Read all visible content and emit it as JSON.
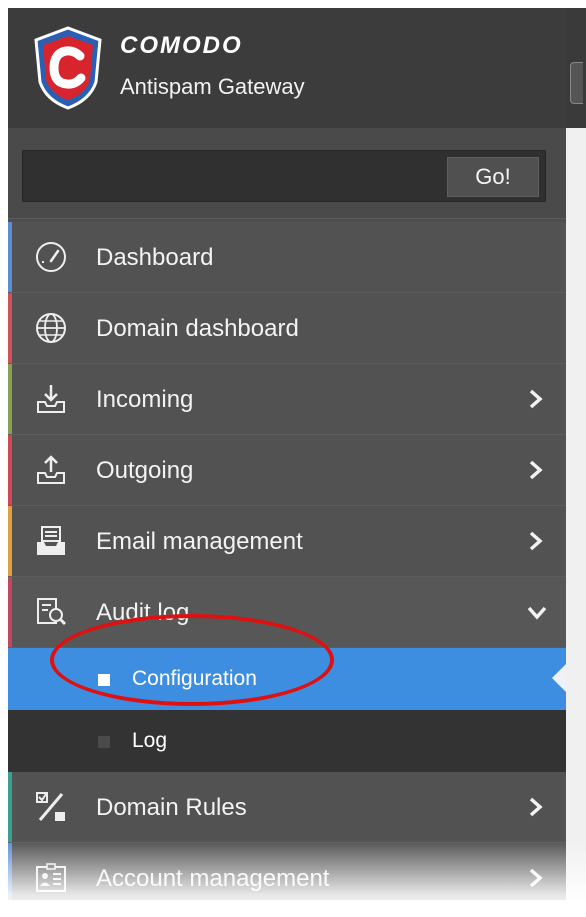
{
  "brand": {
    "name": "COMODO",
    "product": "Antispam Gateway"
  },
  "search": {
    "value": "",
    "placeholder": "",
    "button_label": "Go!"
  },
  "menu": {
    "items": [
      {
        "label": "Dashboard",
        "icon": "dashboard-gauge-icon",
        "stripe": "#5a8fd8",
        "has_arrow": false
      },
      {
        "label": "Domain dashboard",
        "icon": "globe-icon",
        "stripe": "#d0505a",
        "has_arrow": false
      },
      {
        "label": "Incoming",
        "icon": "inbox-download-icon",
        "stripe": "#8aa050",
        "has_arrow": true
      },
      {
        "label": "Outgoing",
        "icon": "outbox-upload-icon",
        "stripe": "#d04858",
        "has_arrow": true
      },
      {
        "label": "Email management",
        "icon": "mail-tray-icon",
        "stripe": "#e0a040",
        "has_arrow": true
      },
      {
        "label": "Audit log",
        "icon": "audit-search-icon",
        "stripe": "#c04860",
        "has_arrow": true,
        "expanded": true
      },
      {
        "label": "Domain Rules",
        "icon": "percent-rules-icon",
        "stripe": "#3aa090",
        "has_arrow": true
      },
      {
        "label": "Account management",
        "icon": "account-card-icon",
        "stripe": "#5a8fd8",
        "has_arrow": true
      }
    ],
    "audit_subitems": [
      {
        "label": "Configuration",
        "active": true
      },
      {
        "label": "Log",
        "active": false
      }
    ]
  },
  "colors": {
    "accent": "#3d8ee0",
    "sidebar_bg": "#525252",
    "highlight_ellipse": "#e01010"
  }
}
